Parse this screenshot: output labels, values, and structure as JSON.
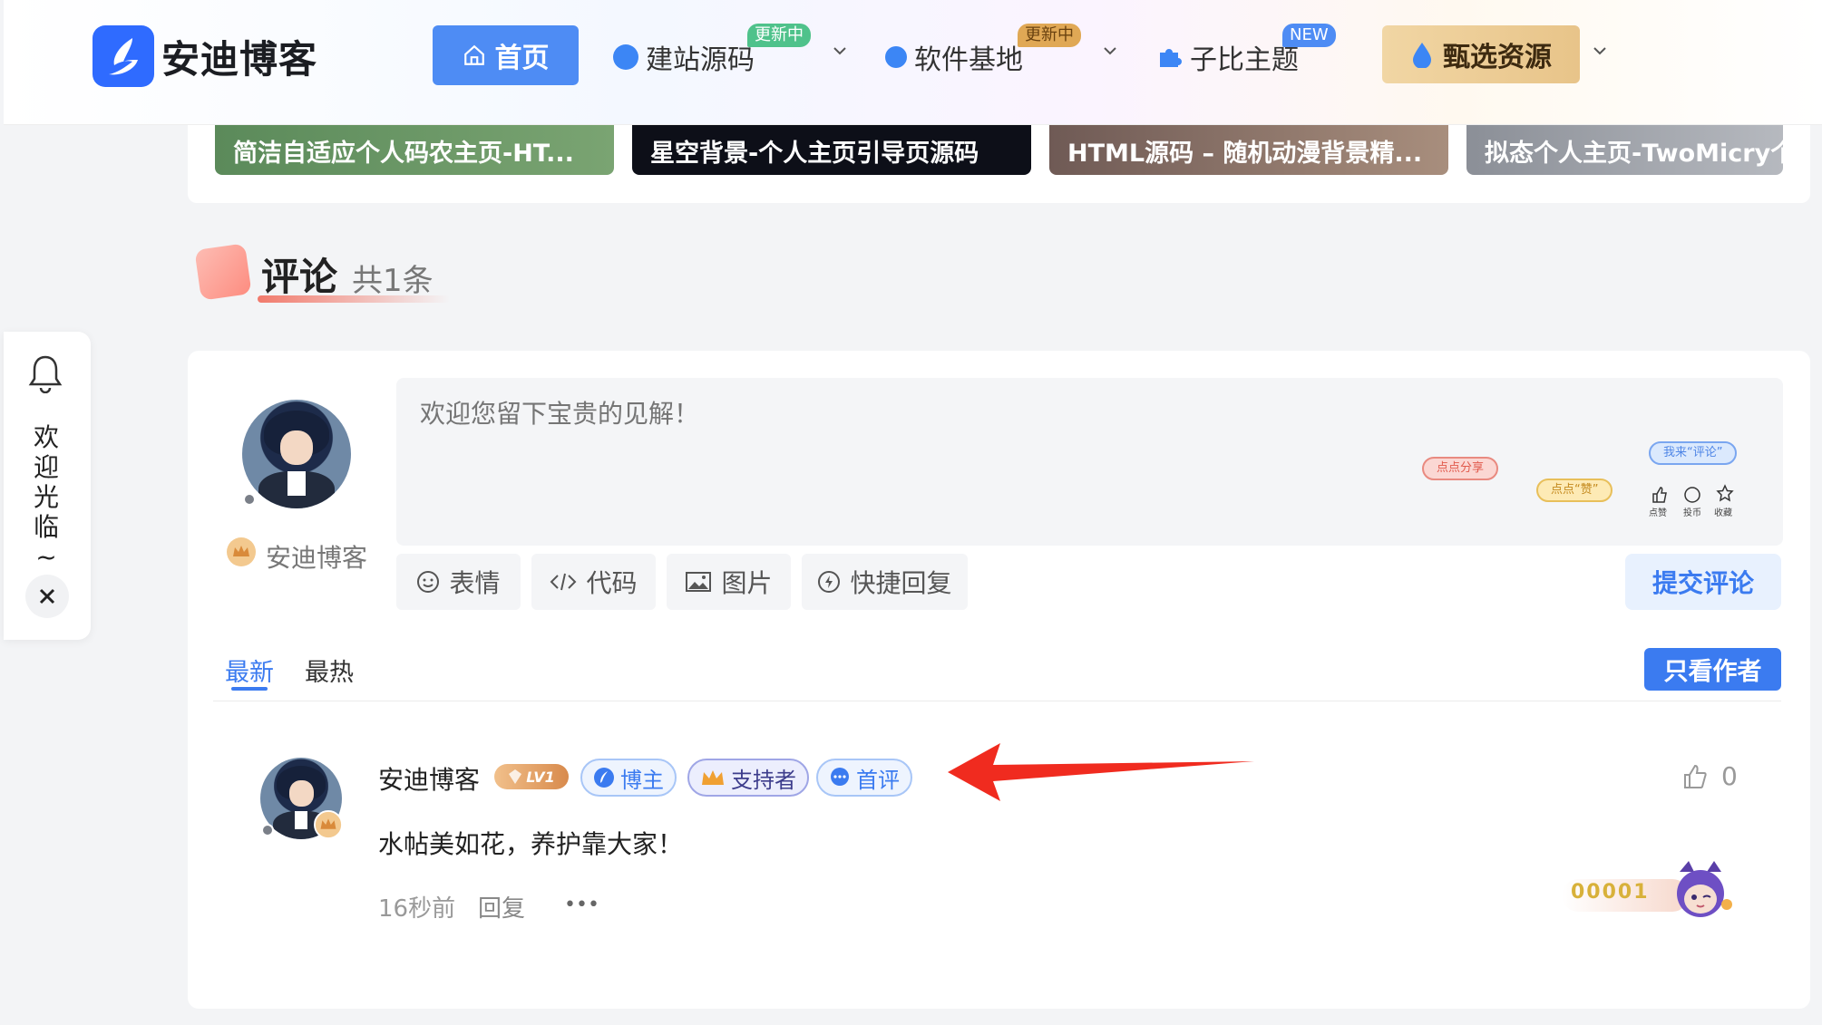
{
  "brand": {
    "name": "安迪博客"
  },
  "nav": {
    "home": "首页",
    "items": [
      {
        "label": "建站源码",
        "badge": "更新中"
      },
      {
        "label": "软件基地",
        "badge": "更新中"
      },
      {
        "label": "子比主题",
        "badge": "NEW"
      }
    ],
    "select": "甄选资源"
  },
  "related_posts": [
    "简洁自适应个人码农主页-HT...",
    "星空背景-个人主页引导页源码",
    "HTML源码 – 随机动漫背景精...",
    "拟态个人主页-TwoMicry个"
  ],
  "section": {
    "title": "评论",
    "count": "共1条"
  },
  "float_widget": {
    "text": [
      "欢",
      "迎",
      "光",
      "临",
      "~"
    ]
  },
  "editor": {
    "user_name": "安迪博客",
    "placeholder": "欢迎您留下宝贵的见解！",
    "stickers": [
      "点点分享",
      "点点“赞”",
      "我来“评论”"
    ],
    "sticker_icons": [
      "点赞",
      "投币",
      "收藏"
    ],
    "tools": [
      "表情",
      "代码",
      "图片",
      "快捷回复"
    ],
    "submit": "提交评论"
  },
  "tabs": {
    "latest": "最新",
    "hot": "最热",
    "author_only": "只看作者"
  },
  "comment": {
    "author": "安迪博客",
    "level": "LV1",
    "tags": [
      "博主",
      "支持者",
      "首评"
    ],
    "body": "水帖美如花，养护靠大家！",
    "time": "16秒前",
    "reply": "回复",
    "more": "•••",
    "likes": "0",
    "deco_code": "00001"
  },
  "colors": {
    "accent": "#3b7bf0",
    "arrow": "#f02b1f",
    "gold": "#e0a855"
  }
}
